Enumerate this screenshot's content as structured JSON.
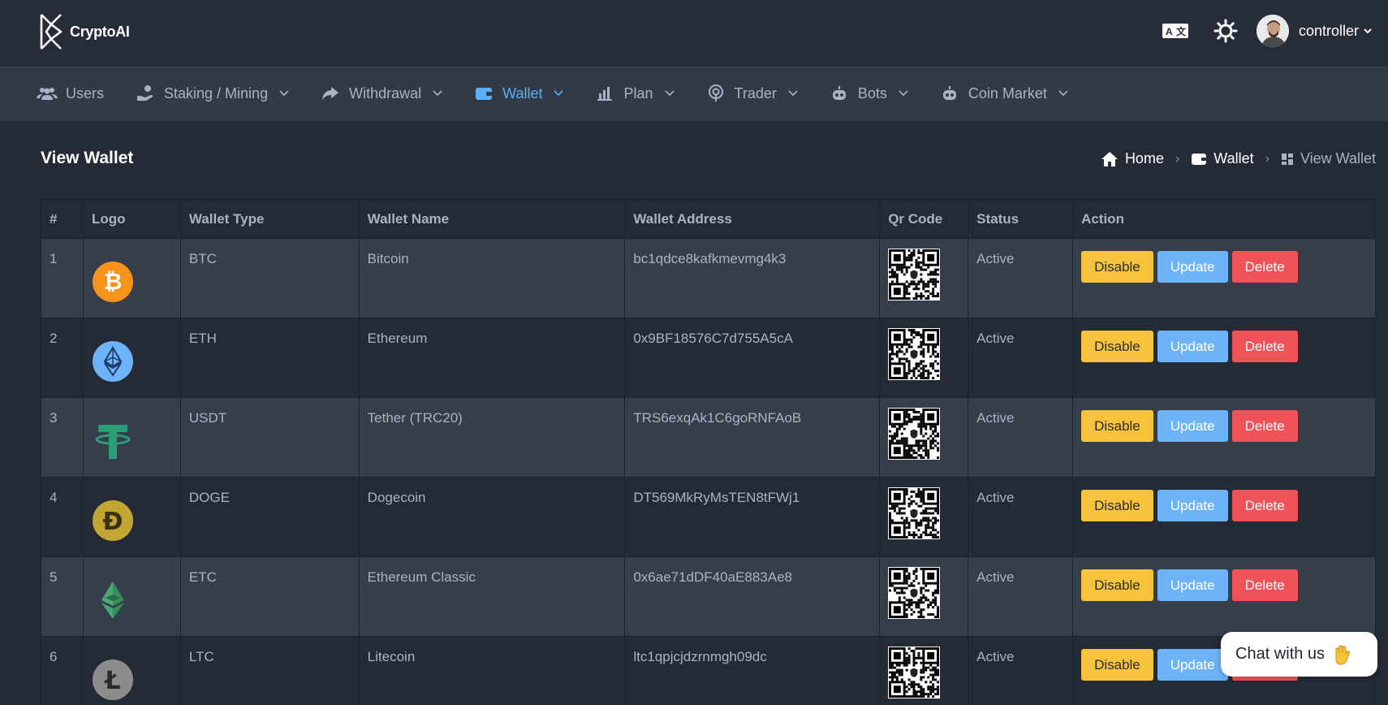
{
  "brand": {
    "name": "CryptoAI"
  },
  "header": {
    "translate_icon": "translate-icon",
    "theme_icon": "sun-icon",
    "user_name": "controller"
  },
  "nav": [
    {
      "label": "Users",
      "icon": "users-icon",
      "has_dropdown": false,
      "active": false
    },
    {
      "label": "Staking / Mining",
      "icon": "hand-coin-icon",
      "has_dropdown": true,
      "active": false
    },
    {
      "label": "Withdrawal",
      "icon": "share-arrow-icon",
      "has_dropdown": true,
      "active": false
    },
    {
      "label": "Wallet",
      "icon": "wallet-icon",
      "has_dropdown": true,
      "active": true
    },
    {
      "label": "Plan",
      "icon": "bar-chart-icon",
      "has_dropdown": true,
      "active": false
    },
    {
      "label": "Trader",
      "icon": "podcast-icon",
      "has_dropdown": true,
      "active": false
    },
    {
      "label": "Bots",
      "icon": "robot-icon",
      "has_dropdown": true,
      "active": false
    },
    {
      "label": "Coin Market",
      "icon": "robot-icon",
      "has_dropdown": true,
      "active": false
    }
  ],
  "page": {
    "title": "View Wallet",
    "breadcrumb": [
      "Home",
      "Wallet",
      "View Wallet"
    ]
  },
  "table": {
    "columns": [
      "#",
      "Logo",
      "Wallet Type",
      "Wallet Name",
      "Wallet Address",
      "Qr Code",
      "Status",
      "Action"
    ],
    "actions": {
      "disable": "Disable",
      "update": "Update",
      "delete": "Delete"
    },
    "rows": [
      {
        "num": "1",
        "type": "BTC",
        "name": "Bitcoin",
        "address": "bc1qdce8kafkmevmg4k3",
        "status": "Active",
        "logo": "bitcoin-icon"
      },
      {
        "num": "2",
        "type": "ETH",
        "name": "Ethereum",
        "address": "0x9BF18576C7d755A5cA",
        "status": "Active",
        "logo": "ethereum-icon"
      },
      {
        "num": "3",
        "type": "USDT",
        "name": "Tether (TRC20)",
        "address": "TRS6exqAk1C6goRNFAoB",
        "status": "Active",
        "logo": "tether-icon"
      },
      {
        "num": "4",
        "type": "DOGE",
        "name": "Dogecoin",
        "address": "DT569MkRyMsTEN8tFWj1",
        "status": "Active",
        "logo": "dogecoin-icon"
      },
      {
        "num": "5",
        "type": "ETC",
        "name": "Ethereum Classic",
        "address": "0x6ae71dDF40aE883Ae8",
        "status": "Active",
        "logo": "ethereum-classic-icon"
      },
      {
        "num": "6",
        "type": "LTC",
        "name": "Litecoin",
        "address": "ltc1qpjcjdzrnmgh09dc",
        "status": "Active",
        "logo": "litecoin-icon"
      }
    ]
  },
  "chat": {
    "label": "Chat with us"
  },
  "colors": {
    "bg": "#252b36",
    "nav_bg": "#323a47",
    "accent": "#5ab0f8",
    "disable": "#f7c23c",
    "update": "#6cb3f7",
    "delete": "#f1525a"
  }
}
